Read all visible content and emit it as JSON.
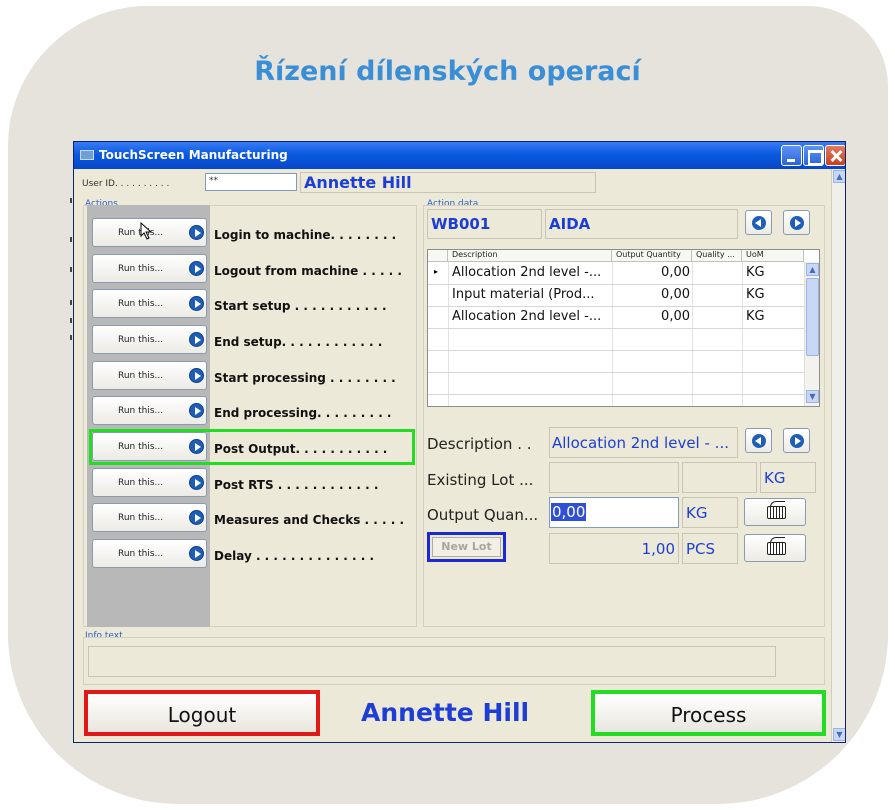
{
  "page_title": "Řízení dílenských operací",
  "window": {
    "title": "TouchScreen Manufacturing"
  },
  "user": {
    "id_label": "User ID. . . . . . . . . .",
    "id_value": "**",
    "name": "Annette Hill"
  },
  "actions": {
    "group_label": "Actions",
    "run_labels": [
      "Run this...",
      "Run this...",
      "Run this...",
      "Run this...",
      "Run this...",
      "Run this...",
      "Run this...",
      "Run this...",
      "Run this...",
      "Run this..."
    ],
    "items": [
      "Login to machine. . . . . . . .",
      "Logout from machine . . . . .",
      "Start setup . . . . . . . . . . .",
      "End setup. . . . . . . . . . . .",
      "Start processing . . . . . . . .",
      "End processing. . . . . . . . .",
      "Post Output. . . . . . . . . . .",
      "Post RTS . . . . . . . . . . . .",
      "Measures and Checks . . . . .",
      "Delay . . . . . . . . . . . . . ."
    ]
  },
  "action_data": {
    "group_label": "Action data",
    "machine": "WB001",
    "operator": "AIDA",
    "columns": [
      "Description",
      "Output Quantity",
      "Quality ...",
      "UoM"
    ],
    "rows": [
      {
        "description": "Allocation 2nd level -...",
        "output_qty": "0,00",
        "quality": "",
        "uom": "KG"
      },
      {
        "description": "Input material (Prod...",
        "output_qty": "0,00",
        "quality": "",
        "uom": "KG"
      },
      {
        "description": "Allocation 2nd level -...",
        "output_qty": "0,00",
        "quality": "",
        "uom": "KG"
      }
    ],
    "description_label": "Description . .",
    "description_value": "Allocation 2nd level - ...",
    "existing_lot_label": "Existing Lot ...",
    "existing_lot_uom": "KG",
    "output_qty_label": "Output Quan...",
    "output_qty_value": "0,00",
    "output_qty_uom": "KG",
    "new_lot_label": "New Lot",
    "pcs_value": "1,00",
    "pcs_uom": "PCS"
  },
  "info": {
    "label": "Info text",
    "text": ""
  },
  "footer": {
    "logout_label": "Logout",
    "user_name": "Annette Hill",
    "process_label": "Process"
  },
  "colors": {
    "accent_blue": "#1c3ed6",
    "title_blue": "#3a8ed6",
    "highlight_green": "#22dd22",
    "highlight_red": "#e01818",
    "highlight_dark_blue": "#1a2ad0"
  }
}
